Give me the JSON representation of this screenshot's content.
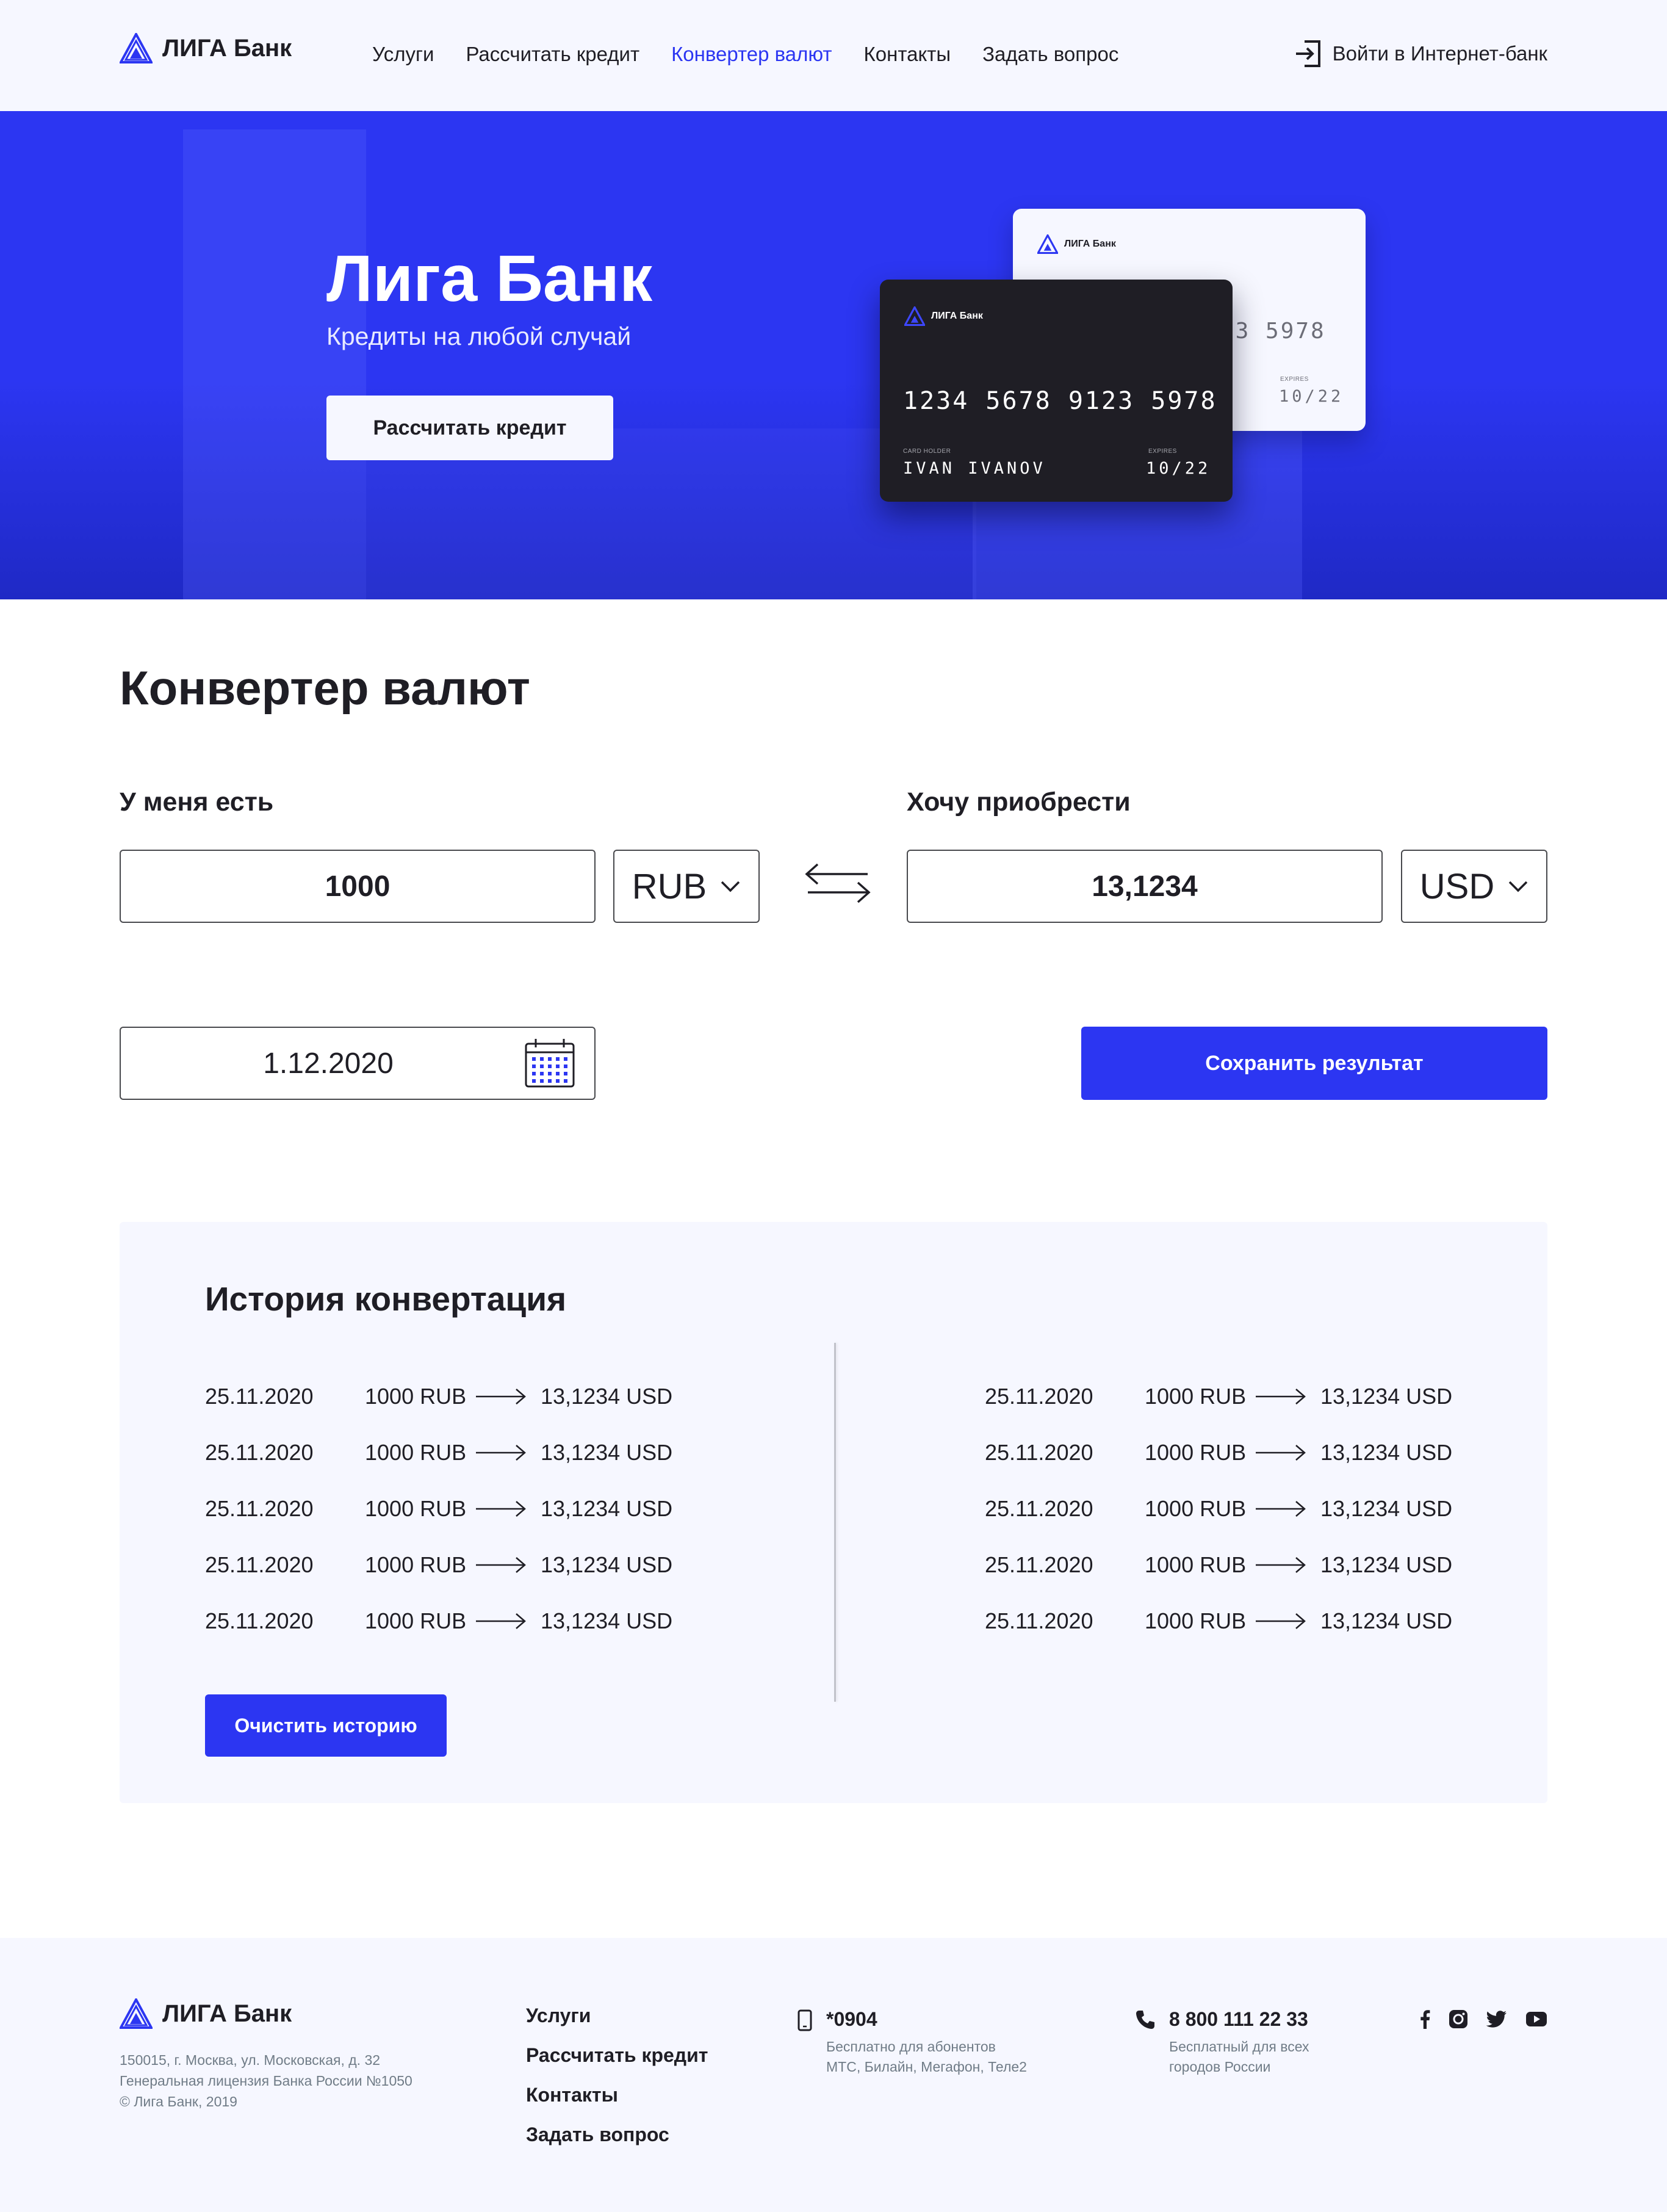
{
  "brand": {
    "name": "ЛИГА Банк",
    "accent_color": "#2C36F2",
    "dark_color": "#1F1E25",
    "light_bg": "#F6F7FF"
  },
  "header": {
    "nav": [
      "Услуги",
      "Рассчитать кредит",
      "Конвертер валют",
      "Контакты",
      "Задать вопрос"
    ],
    "active_nav": "Конвертер валют",
    "login_label": "Войти в Интернет-банк",
    "login_icon": "login-icon"
  },
  "hero": {
    "title": "Лига Банк",
    "subtitle": "Кредиты на любой случай",
    "button_label": "Рассчитать кредит",
    "card_back": {
      "bank": "ЛИГА Банк",
      "number_fragment": "23 5978",
      "expires_label": "EXPIRES",
      "expires": "10/22"
    },
    "card_front": {
      "bank": "ЛИГА Банк",
      "number": "1234 5678 9123 5978",
      "holder_label": "CARD HOLDER",
      "holder": "IVAN IVANOV",
      "expires_label": "EXPIRES",
      "expires": "10/22"
    }
  },
  "converter": {
    "title": "Конвертер валют",
    "have_label": "У меня есть",
    "have_value": "1000",
    "have_currency": "RUB",
    "want_label": "Хочу приобрести",
    "want_value": "13,1234",
    "want_currency": "USD",
    "swap_icon": "swap-arrows-icon",
    "date_value": "1.12.2020",
    "calendar_icon": "calendar-icon",
    "save_label": "Сохранить результат"
  },
  "history": {
    "title": "История конвертация",
    "left": [
      {
        "date": "25.11.2020",
        "from": "1000 RUB",
        "to": "13,1234 USD"
      },
      {
        "date": "25.11.2020",
        "from": "1000 RUB",
        "to": "13,1234 USD"
      },
      {
        "date": "25.11.2020",
        "from": "1000 RUB",
        "to": "13,1234 USD"
      },
      {
        "date": "25.11.2020",
        "from": "1000 RUB",
        "to": "13,1234 USD"
      },
      {
        "date": "25.11.2020",
        "from": "1000 RUB",
        "to": "13,1234 USD"
      }
    ],
    "right": [
      {
        "date": "25.11.2020",
        "from": "1000 RUB",
        "to": "13,1234 USD"
      },
      {
        "date": "25.11.2020",
        "from": "1000 RUB",
        "to": "13,1234 USD"
      },
      {
        "date": "25.11.2020",
        "from": "1000 RUB",
        "to": "13,1234 USD"
      },
      {
        "date": "25.11.2020",
        "from": "1000 RUB",
        "to": "13,1234 USD"
      },
      {
        "date": "25.11.2020",
        "from": "1000 RUB",
        "to": "13,1234 USD"
      }
    ],
    "clear_label": "Очистить историю"
  },
  "footer": {
    "brand": "ЛИГА Банк",
    "address": [
      "150015, г. Москва, ул. Московская, д. 32",
      "Генеральная лицензия Банка России №1050",
      "© Лига Банк, 2019"
    ],
    "nav": [
      "Услуги",
      "Рассчитать кредит",
      "Контакты",
      "Задать вопрос"
    ],
    "mobile": {
      "number": "*0904",
      "note": [
        "Бесплатно для абонентов",
        "МТС, Билайн, Мегафон, Теле2"
      ]
    },
    "phone": {
      "number": "8 800 111 22 33",
      "note": [
        "Бесплатный для всех",
        "городов России"
      ]
    },
    "socials": [
      "facebook-icon",
      "instagram-icon",
      "twitter-icon",
      "youtube-icon"
    ]
  }
}
